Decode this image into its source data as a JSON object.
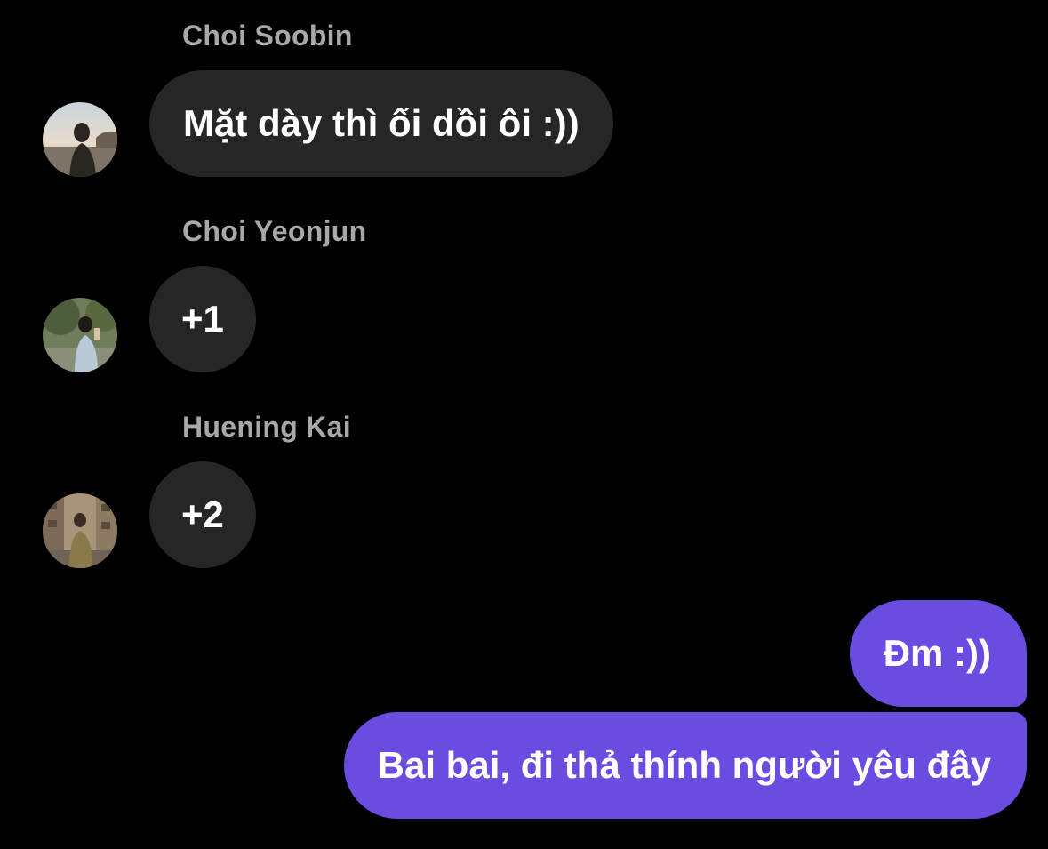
{
  "messages": [
    {
      "sender": "Choi Soobin",
      "avatar": "avatar-choi-soobin",
      "text": "Mặt dày thì ối dồi ôi :))"
    },
    {
      "sender": "Choi Yeonjun",
      "avatar": "avatar-choi-yeonjun",
      "text": "+1"
    },
    {
      "sender": "Huening Kai",
      "avatar": "avatar-huening-kai",
      "text": "+2"
    }
  ],
  "outgoing": [
    {
      "text": "Đm :))"
    },
    {
      "text": "Bai bai, đi thả thính người yêu đây"
    }
  ],
  "colors": {
    "background": "#000000",
    "incoming_bubble": "#262626",
    "outgoing_bubble": "#6a4ce0",
    "sender_name": "#a8a8a8",
    "text": "#ffffff"
  }
}
